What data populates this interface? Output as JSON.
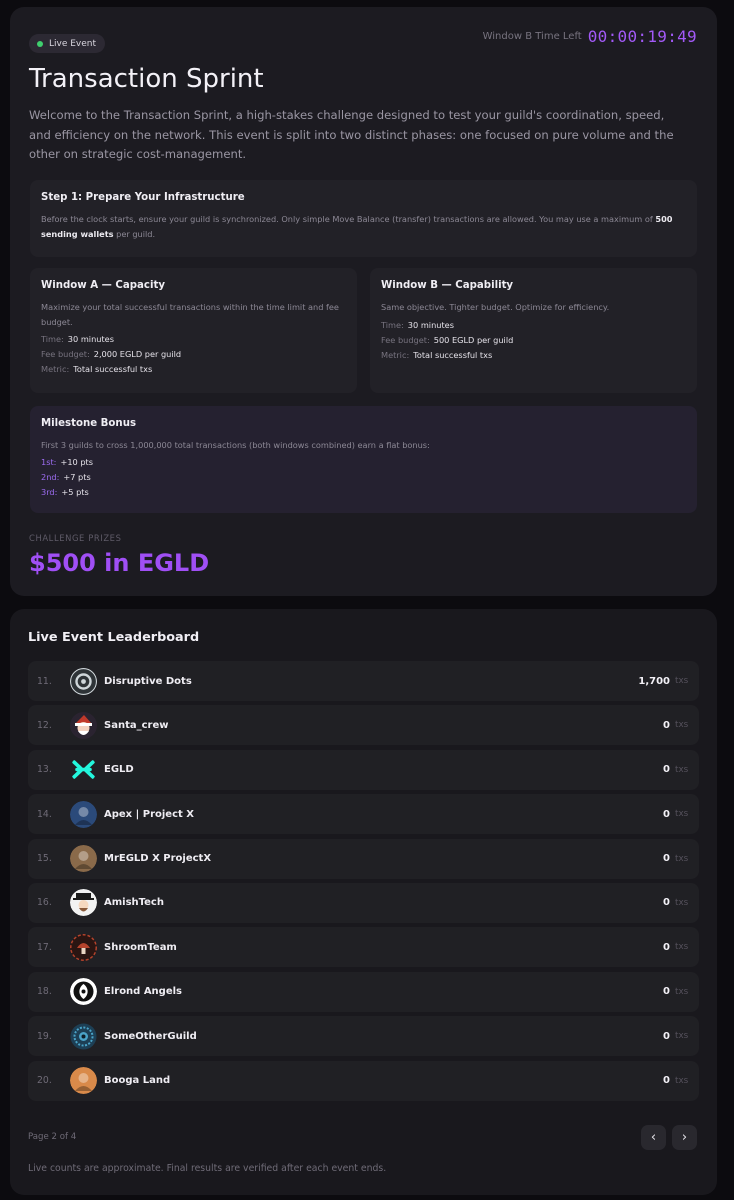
{
  "event": {
    "badge": "Live Event",
    "timer_label": "Window B Time Left",
    "timer_value": "00:00:19:49",
    "title": "Transaction Sprint",
    "intro": "Welcome to the Transaction Sprint, a high-stakes challenge designed to test your guild's coordination, speed, and efficiency on the network. This event is split into two distinct phases: one focused on pure volume and the other on strategic cost-management.",
    "step": {
      "title": "Step 1: Prepare Your Infrastructure",
      "text_before": "Before the clock starts, ensure your guild is synchronized. Only simple Move Balance (transfer) transactions are allowed. You may use a maximum of ",
      "text_bold": "500 sending wallets",
      "text_after": " per guild."
    },
    "window_a": {
      "title": "Window A — Capacity",
      "desc": "Maximize your total successful transactions within the time limit and fee budget.",
      "time_label": "Time:",
      "time_value": "30 minutes",
      "fee_label": "Fee budget:",
      "fee_value": "2,000 EGLD per guild",
      "metric_label": "Metric:",
      "metric_value": "Total successful txs"
    },
    "window_b": {
      "title": "Window B — Capability",
      "desc": "Same objective. Tighter budget. Optimize for efficiency.",
      "time_label": "Time:",
      "time_value": "30 minutes",
      "fee_label": "Fee budget:",
      "fee_value": "500 EGLD per guild",
      "metric_label": "Metric:",
      "metric_value": "Total successful txs"
    },
    "milestone": {
      "title": "Milestone Bonus",
      "desc": "First 3 guilds to cross 1,000,000 total transactions (both windows combined) earn a flat bonus:",
      "bonuses": [
        {
          "label": "1st:",
          "value": "+10 pts"
        },
        {
          "label": "2nd:",
          "value": "+7 pts"
        },
        {
          "label": "3rd:",
          "value": "+5 pts"
        }
      ]
    },
    "prizes_label": "CHALLENGE PRIZES",
    "prizes_value": "$500 in EGLD"
  },
  "leaderboard": {
    "title": "Live Event Leaderboard",
    "unit": "txs",
    "rows": [
      {
        "rank": "11.",
        "name": "Disruptive Dots",
        "count": "1,700",
        "avatar": "dots-avatar-icon",
        "color": "#cfd6da"
      },
      {
        "rank": "12.",
        "name": "Santa_crew",
        "count": "0",
        "avatar": "santa-avatar-icon",
        "color": "#c0392b"
      },
      {
        "rank": "13.",
        "name": "EGLD",
        "count": "0",
        "avatar": "egld-logo-icon",
        "color": "#23f7dd"
      },
      {
        "rank": "14.",
        "name": "Apex | Project X",
        "count": "0",
        "avatar": "apex-avatar-icon",
        "color": "#2b4a7a"
      },
      {
        "rank": "15.",
        "name": "MrEGLD X ProjectX",
        "count": "0",
        "avatar": "mregld-avatar-icon",
        "color": "#8a6a4a"
      },
      {
        "rank": "16.",
        "name": "AmishTech",
        "count": "0",
        "avatar": "amish-avatar-icon",
        "color": "#f2f2f2"
      },
      {
        "rank": "17.",
        "name": "ShroomTeam",
        "count": "0",
        "avatar": "shroom-avatar-icon",
        "color": "#b5432c"
      },
      {
        "rank": "18.",
        "name": "Elrond Angels",
        "count": "0",
        "avatar": "angels-avatar-icon",
        "color": "#ffffff"
      },
      {
        "rank": "19.",
        "name": "SomeOtherGuild",
        "count": "0",
        "avatar": "eye-avatar-icon",
        "color": "#4aa3c8"
      },
      {
        "rank": "20.",
        "name": "Booga Land",
        "count": "0",
        "avatar": "booga-avatar-icon",
        "color": "#d98a4a"
      }
    ],
    "page_info": "Page 2 of 4",
    "prev_label": "‹",
    "next_label": "›",
    "footnote": "Live counts are approximate. Final results are verified after each event ends."
  }
}
